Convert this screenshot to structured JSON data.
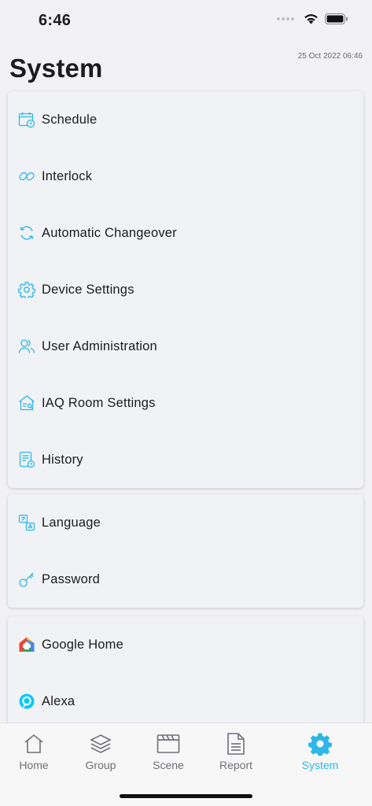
{
  "status_bar": {
    "time": "6:46"
  },
  "header": {
    "title": "System",
    "timestamp": "25 Oct 2022 06:46"
  },
  "accent_color": "#2cb7e8",
  "groups": [
    {
      "items": [
        {
          "label": "Schedule",
          "icon": "calendar-clock-icon"
        },
        {
          "label": "Interlock",
          "icon": "link-icon"
        },
        {
          "label": "Automatic Changeover",
          "icon": "refresh-icon"
        },
        {
          "label": "Device Settings",
          "icon": "gear-icon"
        },
        {
          "label": "User Administration",
          "icon": "users-icon"
        },
        {
          "label": "IAQ Room Settings",
          "icon": "house-settings-icon"
        },
        {
          "label": "History",
          "icon": "history-document-icon"
        }
      ]
    },
    {
      "items": [
        {
          "label": "Language",
          "icon": "language-icon"
        },
        {
          "label": "Password",
          "icon": "key-icon"
        }
      ]
    },
    {
      "items": [
        {
          "label": "Google Home",
          "icon": "google-home-icon"
        },
        {
          "label": "Alexa",
          "icon": "alexa-icon"
        }
      ]
    }
  ],
  "tabs": [
    {
      "label": "Home",
      "icon": "home-icon"
    },
    {
      "label": "Group",
      "icon": "layers-icon"
    },
    {
      "label": "Scene",
      "icon": "clapperboard-icon"
    },
    {
      "label": "Report",
      "icon": "report-icon"
    },
    {
      "label": "System",
      "icon": "gear-icon",
      "active": true
    }
  ]
}
